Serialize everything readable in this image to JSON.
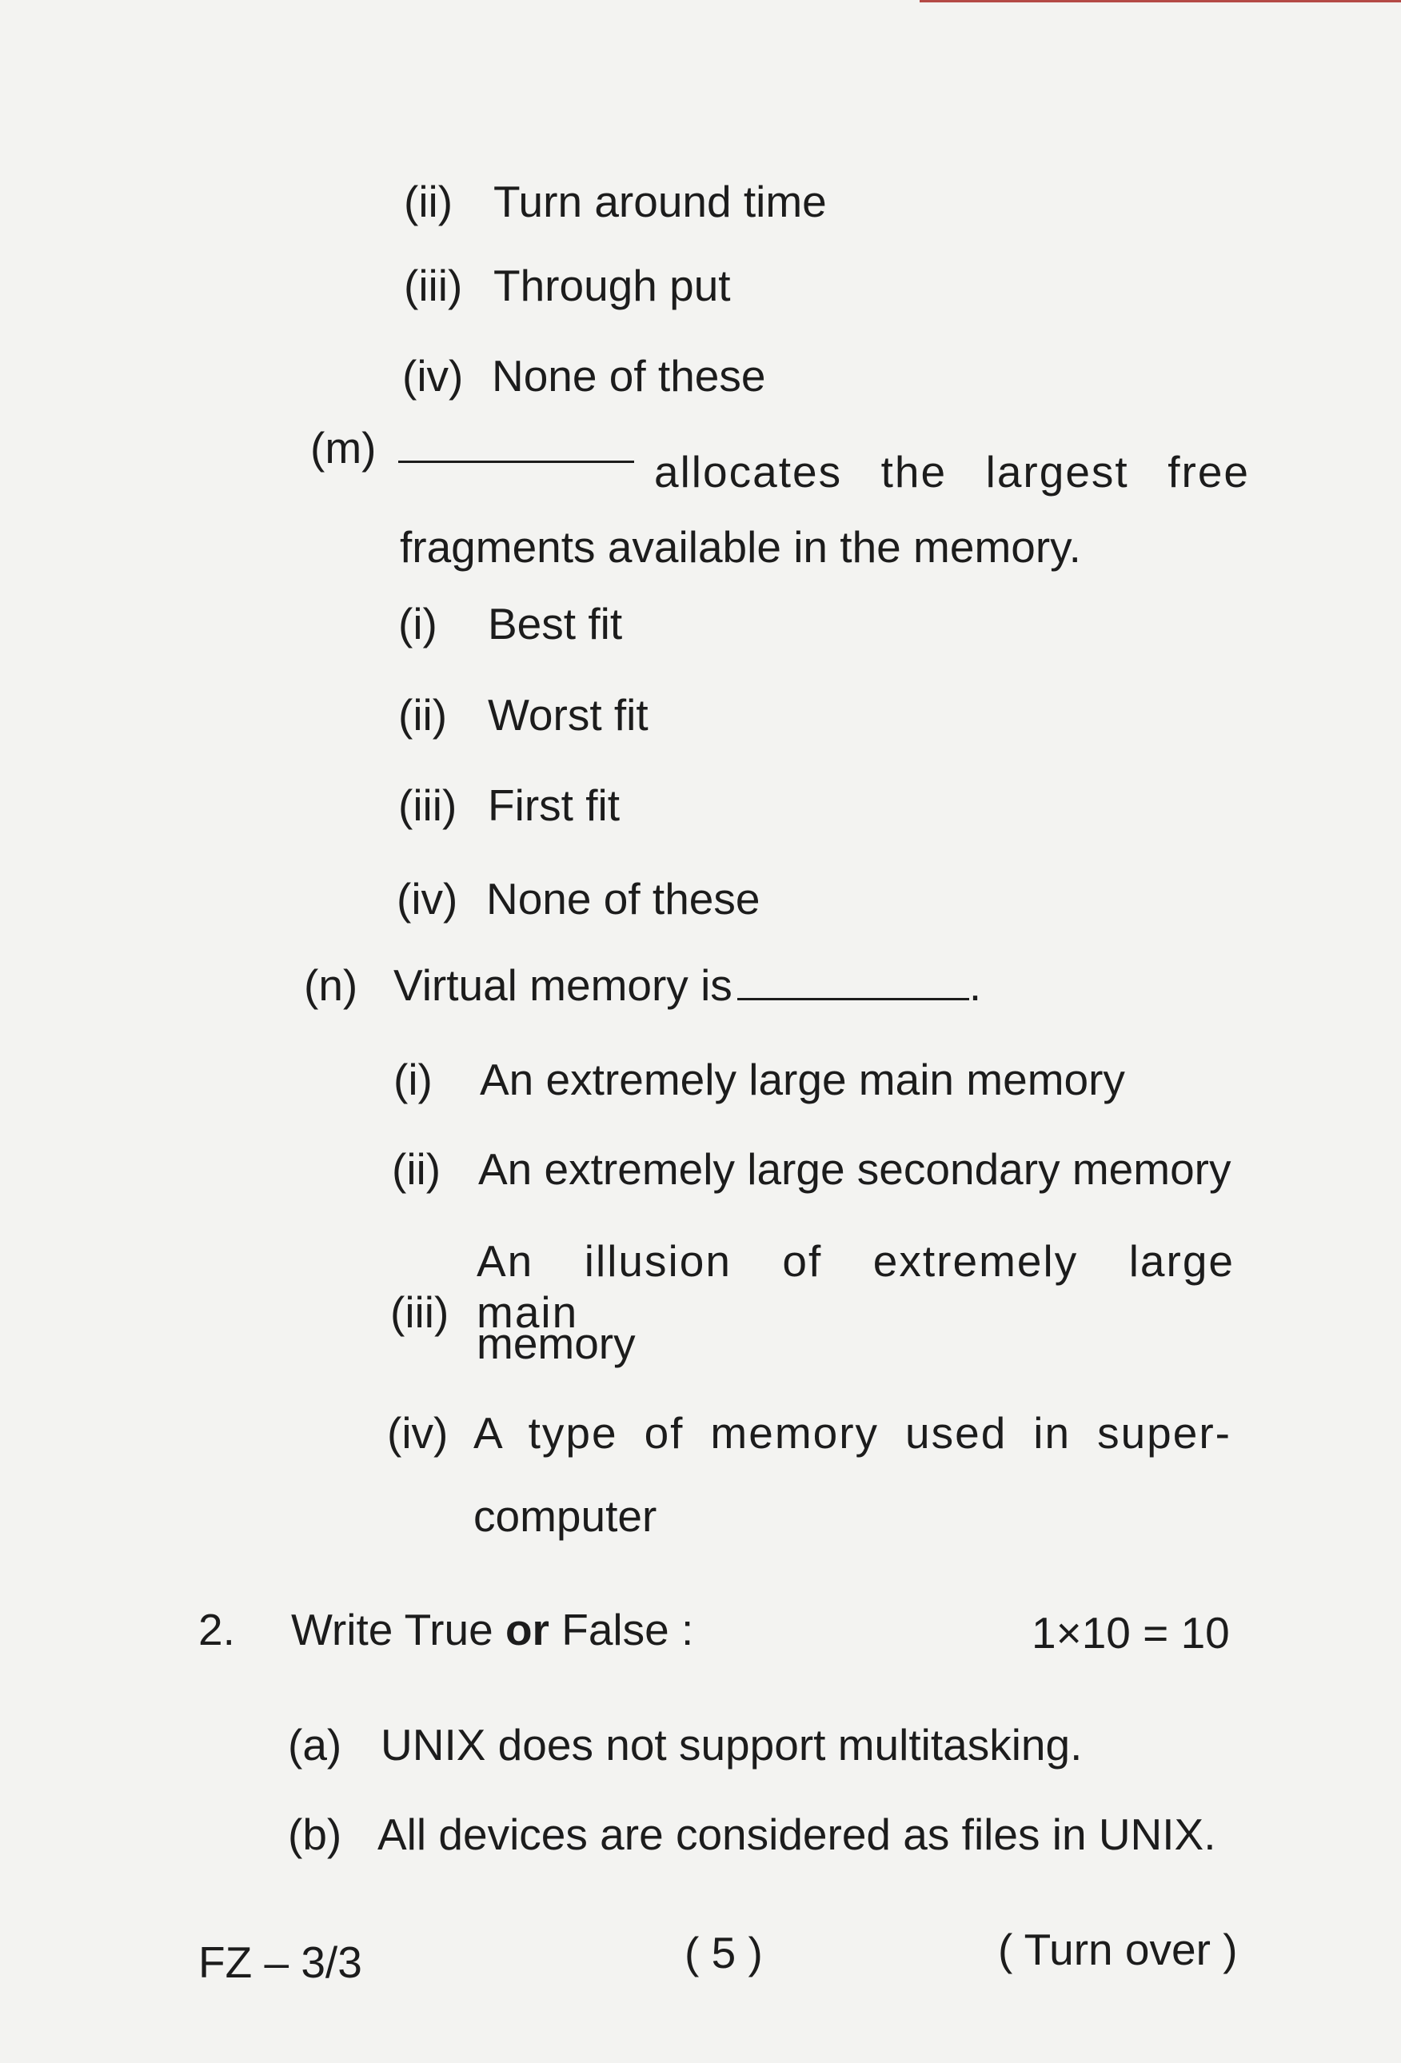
{
  "prev_question_options": [
    {
      "label": "(ii)",
      "text": "Turn around time"
    },
    {
      "label": "(iii)",
      "text": "Through put"
    },
    {
      "label": "(iv)",
      "text": "None of these"
    }
  ],
  "question_m": {
    "label": "(m)",
    "stem_line1": "allocates the largest free",
    "stem_line2": "fragments available in the memory.",
    "options": [
      {
        "label": "(i)",
        "text": "Best fit"
      },
      {
        "label": "(ii)",
        "text": "Worst fit"
      },
      {
        "label": "(iii)",
        "text": "First fit"
      },
      {
        "label": "(iv)",
        "text": "None of these"
      }
    ]
  },
  "question_n": {
    "label": "(n)",
    "stem": "Virtual memory is",
    "stem_end": ".",
    "options": [
      {
        "label": "(i)",
        "text": "An extremely large main memory"
      },
      {
        "label": "(ii)",
        "text": "An extremely large secondary memory"
      },
      {
        "label": "(iii)",
        "text": "An illusion of extremely large main",
        "text2": "memory"
      },
      {
        "label": "(iv)",
        "text": "A type of memory used in super-",
        "text2": "computer"
      }
    ]
  },
  "section_2": {
    "number": "2.",
    "title_part1": "Write True ",
    "title_or": "or",
    "title_part2": " False :",
    "marks": "1×10 = 10",
    "items": [
      {
        "label": "(a)",
        "text": "UNIX does not support multitasking."
      },
      {
        "label": "(b)",
        "text": "All devices are considered as files in UNIX."
      }
    ]
  },
  "footer": {
    "code": "FZ – 3/3",
    "page": "( 5 )",
    "turn": "( Turn over )"
  }
}
